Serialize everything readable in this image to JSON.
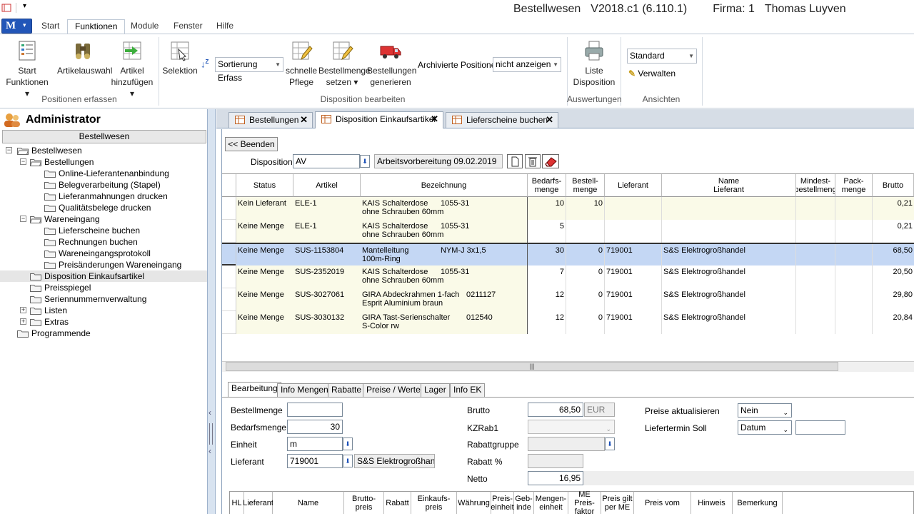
{
  "window": {
    "app": "Bestellwesen",
    "version": "V2018.c1 (6.110.1)",
    "company": "Firma: 1",
    "user": "Thomas Luyven"
  },
  "menu_tabs": [
    "Start",
    "Funktionen",
    "Module",
    "Fenster",
    "Hilfe"
  ],
  "ribbon": {
    "start_funktionen": [
      "Start",
      "Funktionen"
    ],
    "artikelauswahl": "Artikelauswahl",
    "artikel_hinzufuegen": [
      "Artikel",
      "hinzufügen"
    ],
    "group1": "Positionen erfassen",
    "selektion": "Selektion",
    "sortierung": "Sortierung Erfass",
    "schnelle_pflege": [
      "schnelle",
      "Pflege"
    ],
    "bestellmenge_setzen": [
      "Bestellmenge",
      "setzen"
    ],
    "bestellungen_generieren": [
      "Bestellungen",
      "generieren"
    ],
    "archivierte_label": "Archivierte Positionen",
    "archivierte_value": "nicht anzeigen",
    "group2": "Disposition bearbeiten",
    "liste_disposition": [
      "Liste",
      "Disposition"
    ],
    "group3": "Auswertungen",
    "ansicht_value": "Standard",
    "verwalten": "Verwalten",
    "group4": "Ansichten"
  },
  "left": {
    "title": "Administrator",
    "header": "Bestellwesen",
    "tree": [
      {
        "label": "Bestellwesen",
        "level": 0,
        "exp": "−"
      },
      {
        "label": "Bestellungen",
        "level": 1,
        "exp": "−"
      },
      {
        "label": "Online-Lieferantenanbindung",
        "level": 2
      },
      {
        "label": "Belegverarbeitung (Stapel)",
        "level": 2
      },
      {
        "label": "Lieferanmahnungen drucken",
        "level": 2
      },
      {
        "label": "Qualitätsbelege drucken",
        "level": 2
      },
      {
        "label": "Wareneingang",
        "level": 1,
        "exp": "−"
      },
      {
        "label": "Lieferscheine buchen",
        "level": 2
      },
      {
        "label": "Rechnungen buchen",
        "level": 2
      },
      {
        "label": "Wareneingangsprotokoll",
        "level": 2
      },
      {
        "label": "Preisänderungen Wareneingang",
        "level": 2
      },
      {
        "label": "Disposition Einkaufsartikel",
        "level": 1,
        "selected": true
      },
      {
        "label": "Preisspiegel",
        "level": 1
      },
      {
        "label": "Seriennummernverwaltung",
        "level": 1
      },
      {
        "label": "Listen",
        "level": 1,
        "exp": "+"
      },
      {
        "label": "Extras",
        "level": 1,
        "exp": "+"
      },
      {
        "label": "Programmende",
        "level": 0
      }
    ]
  },
  "doc_tabs": [
    {
      "label": "Bestellungen"
    },
    {
      "label": "Disposition Einkaufsartikel",
      "selected": true
    },
    {
      "label": "Lieferscheine buchen"
    }
  ],
  "content": {
    "beenden": "<< Beenden",
    "disposition_label": "Disposition",
    "disposition_value": "AV",
    "disposition_desc": "Arbeitsvorbereitung 09.02.2019"
  },
  "grid": {
    "columns": [
      "Status",
      "Artikel",
      "Bezeichnung",
      "Bedarfs-\nmenge",
      "Bestell-\nmenge",
      "Lieferant",
      "Name\nLieferant",
      "Mindest-\nbestellmeng",
      "Pack-\nmenge",
      "Brutto"
    ],
    "rows": [
      {
        "status": "Kein Lieferant",
        "artikel": "ELE-1",
        "bez1": "KAIS Schalterdose",
        "bez1b": "1055-31",
        "bez2": "ohne Schrauben 60mm",
        "bedarf": "10",
        "bestell": "10",
        "lief": "",
        "name": "",
        "brutto": "0,21"
      },
      {
        "status": "Keine Menge",
        "artikel": "ELE-1",
        "bez1": "KAIS Schalterdose",
        "bez1b": "1055-31",
        "bez2": "ohne Schrauben 60mm",
        "bedarf": "5",
        "bestell": "",
        "lief": "",
        "name": "",
        "brutto": "0,21"
      },
      {
        "status": "Keine Menge",
        "artikel": "SUS-1153804",
        "bez1": "Mantelleitung",
        "bez1b": "NYM-J 3x1,5",
        "bez2": "100m-Ring",
        "bedarf": "30",
        "bestell": "0",
        "lief": "719001",
        "name": "S&S Elektrogroßhandel",
        "brutto": "68,50",
        "selected": true
      },
      {
        "status": "Keine Menge",
        "artikel": "SUS-2352019",
        "bez1": "KAIS Schalterdose",
        "bez1b": "1055-31",
        "bez2": "ohne Schrauben 60mm",
        "bedarf": "7",
        "bestell": "0",
        "lief": "719001",
        "name": "S&S Elektrogroßhandel",
        "brutto": "20,50"
      },
      {
        "status": "Keine Menge",
        "artikel": "SUS-3027061",
        "bez1": "GIRA Abdeckrahmen 1-fach",
        "bez1b": "0211127",
        "bez2": "Esprit Aluminium braun",
        "bedarf": "12",
        "bestell": "0",
        "lief": "719001",
        "name": "S&S Elektrogroßhandel",
        "brutto": "29,80"
      },
      {
        "status": "Keine Menge",
        "artikel": "SUS-3030132",
        "bez1": "GIRA Tast-Serienschalter",
        "bez1b": "012540",
        "bez2": "S-Color rw",
        "bedarf": "12",
        "bestell": "0",
        "lief": "719001",
        "name": "S&S Elektrogroßhandel",
        "brutto": "20,84"
      }
    ]
  },
  "bottom_tabs": [
    "Bearbeitung",
    "Info Mengen",
    "Rabatte",
    "Preise / Werte",
    "Lager",
    "Info EK"
  ],
  "form": {
    "bestellmenge_label": "Bestellmenge",
    "bestellmenge": "",
    "bedarfsmenge_label": "Bedarfsmenge",
    "bedarfsmenge": "30",
    "einheit_label": "Einheit",
    "einheit": "m",
    "lieferant_label": "Lieferant",
    "lieferant": "719001",
    "lieferant_name": "S&S Elektrogroßhande",
    "brutto_label": "Brutto",
    "brutto": "68,50",
    "waehrung": "EUR",
    "kzrab1_label": "KZRab1",
    "rabattgruppe_label": "Rabattgruppe",
    "rabatt_label": "Rabatt %",
    "netto_label": "Netto",
    "netto": "16,95",
    "preise_akt_label": "Preise aktualisieren",
    "preise_akt": "Nein",
    "liefertermin_label": "Liefertermin Soll",
    "liefertermin": "Datum"
  },
  "bottom_grid": [
    "HL",
    "Lieferant",
    "Name",
    "Brutto-\npreis",
    "Rabatt",
    "Einkaufs-\npreis",
    "Währung",
    "Preis-\neinheit",
    "Geb-\ninde",
    "Mengen-\neinheit",
    "ME Preis-\nfaktor",
    "Preis gilt\nper ME",
    "Preis vom",
    "Hinweis",
    "Bemerkung"
  ],
  "colors": {
    "row_alt": "#fafae8",
    "row_sel": "#c4d7f4",
    "accent": "#2256b8"
  }
}
